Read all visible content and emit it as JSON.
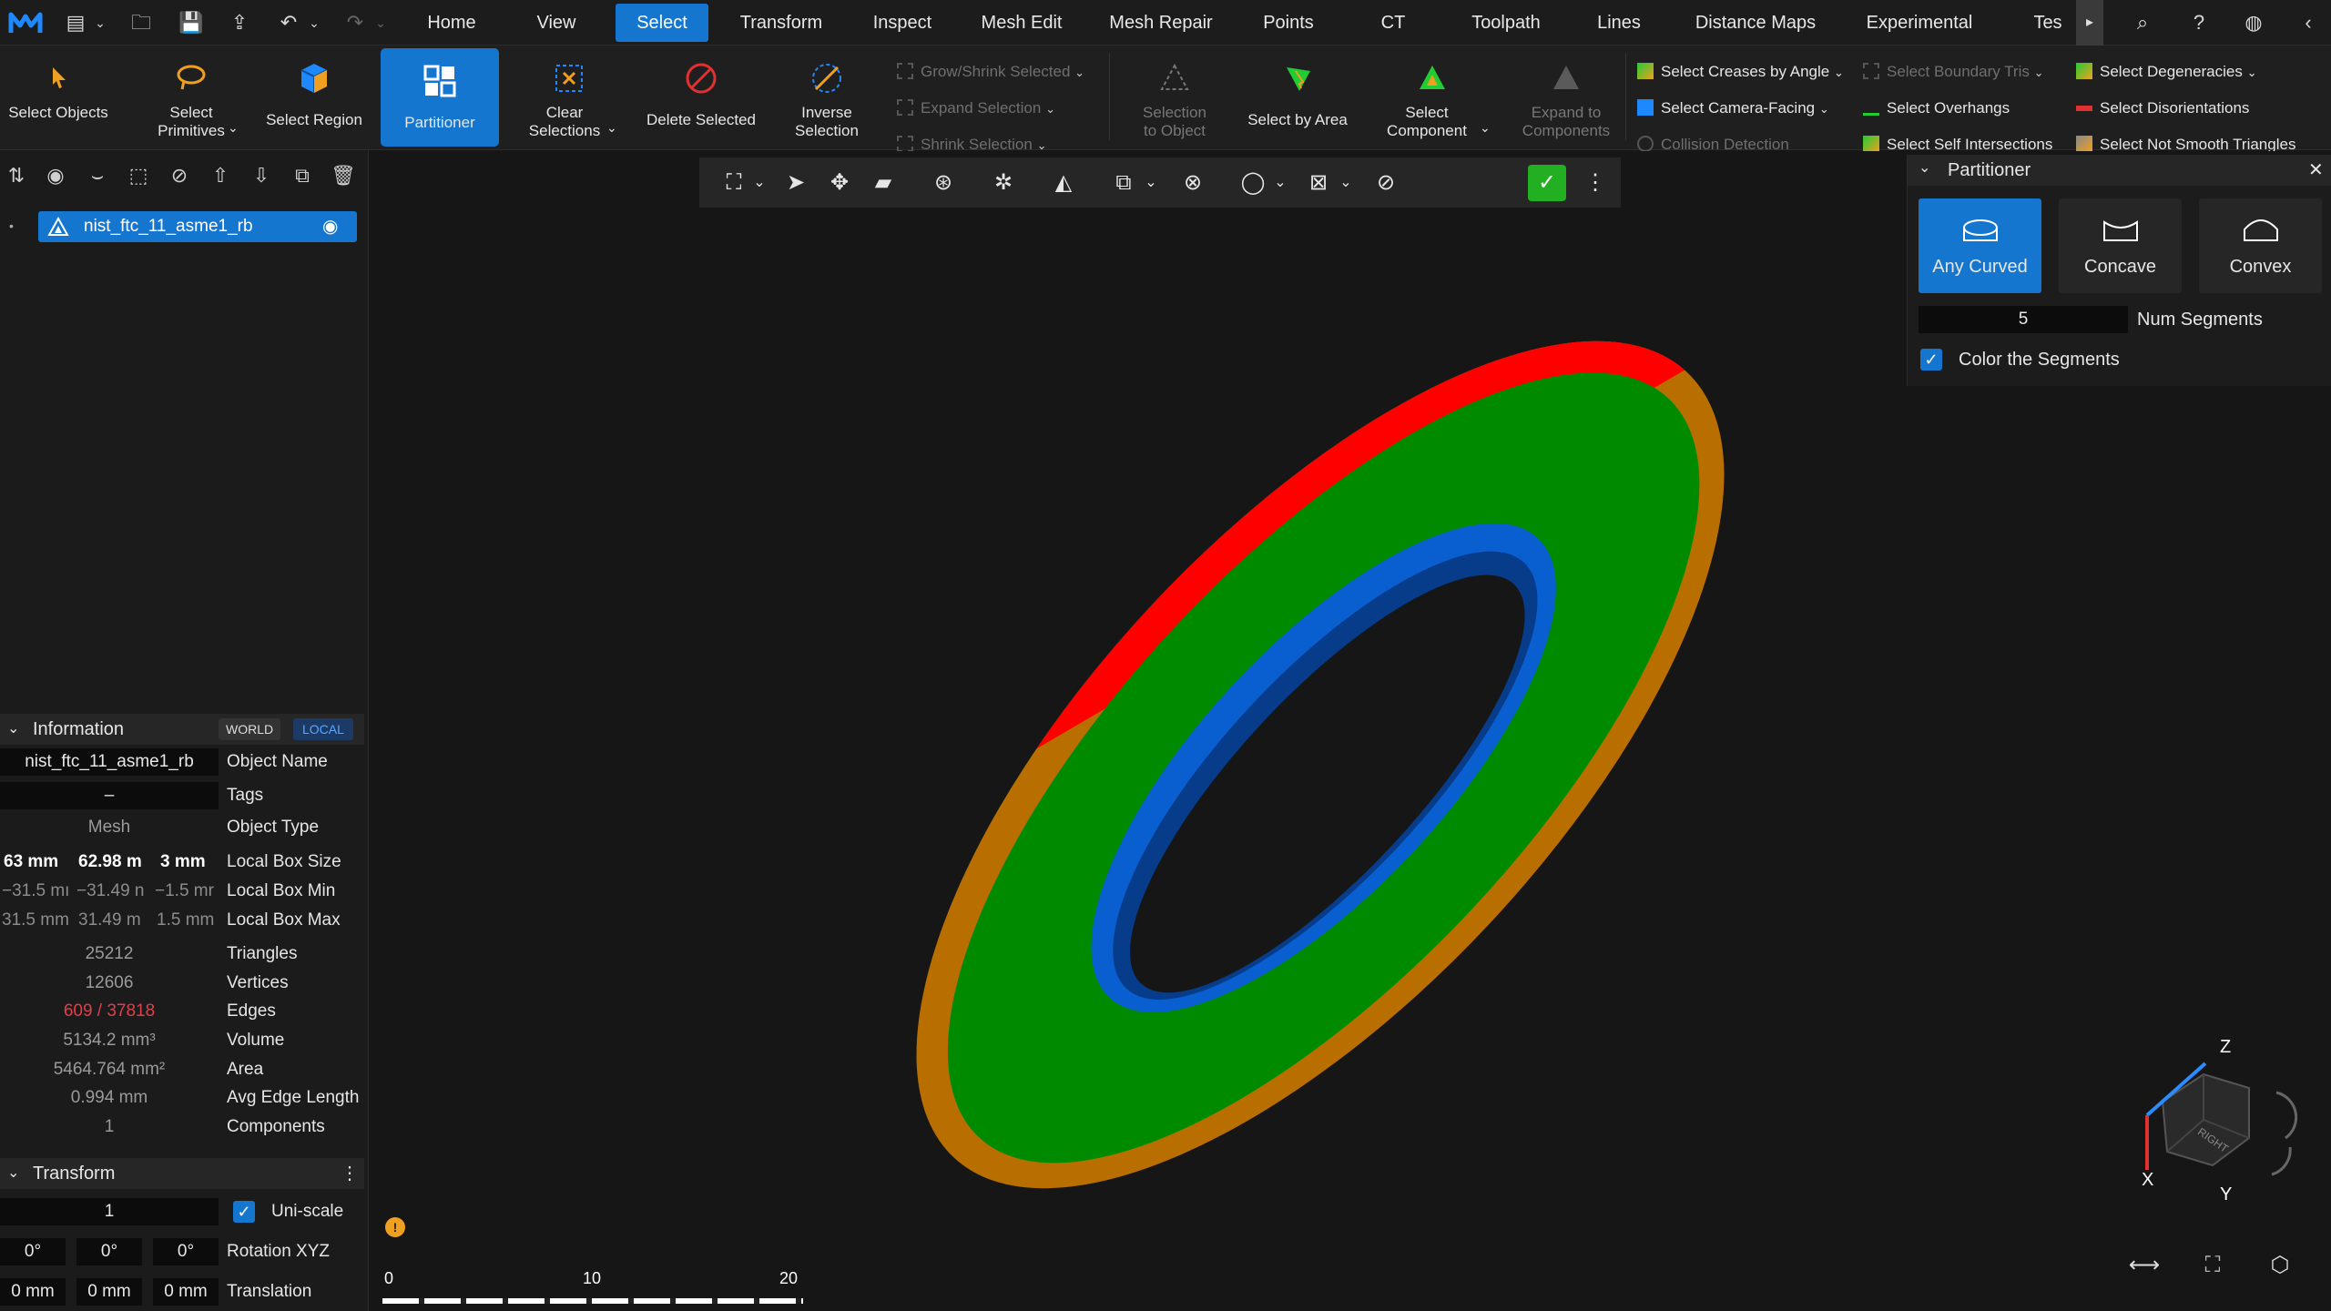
{
  "menu": {
    "tabs": [
      "Home",
      "View",
      "Select",
      "Transform",
      "Inspect",
      "Mesh Edit",
      "Mesh Repair",
      "Points",
      "CT",
      "Toolpath",
      "Lines",
      "Distance Maps",
      "Experimental",
      "Tes"
    ],
    "active_tab": "Select"
  },
  "ribbon": {
    "select_objects": "Select Objects",
    "select_primitives": "Select Primitives",
    "select_region": "Select Region",
    "partitioner": "Partitioner",
    "clear_selections": "Clear Selections",
    "delete_selected": "Delete Selected",
    "inverse_selection": "Inverse Selection",
    "grow_shrink": "Grow/Shrink Selected",
    "expand_selection": "Expand Selection",
    "shrink_selection": "Shrink Selection",
    "selection_to_object": "Selection to Object",
    "select_by_area": "Select by Area",
    "select_component": "Select Component",
    "expand_to_components": "Expand to Components",
    "select_creases": "Select Creases by Angle",
    "select_camera_facing": "Select Camera-Facing",
    "collision_detection": "Collision Detection",
    "select_boundary_tris": "Select Boundary Tris",
    "select_overhangs": "Select Overhangs",
    "select_self_intersections": "Select Self Intersections",
    "select_degeneracies": "Select Degeneracies",
    "select_disorientations": "Select Disorientations",
    "select_not_smooth": "Select Not Smooth Triangles"
  },
  "tree": {
    "object_name": "nist_ftc_11_asme1_rb"
  },
  "information": {
    "title": "Information",
    "world": "WORLD",
    "local": "LOCAL",
    "object_name_value": "nist_ftc_11_asme1_rb",
    "object_name_label": "Object Name",
    "tags_value": "–",
    "tags_label": "Tags",
    "type_value": "Mesh",
    "type_label": "Object Type",
    "box_size": [
      "63 mm",
      "62.98 m",
      "3 mm"
    ],
    "box_size_label": "Local Box Size",
    "box_min": [
      "−31.5 mı",
      "−31.49 n",
      "−1.5 mr"
    ],
    "box_min_label": "Local Box Min",
    "box_max": [
      "31.5 mm",
      "31.49 m",
      "1.5 mm"
    ],
    "box_max_label": "Local Box Max",
    "triangles": "25212",
    "triangles_label": "Triangles",
    "vertices": "12606",
    "vertices_label": "Vertices",
    "edges": "609 / 37818",
    "edges_label": "Edges",
    "volume": "5134.2 mm³",
    "volume_label": "Volume",
    "area": "5464.764 mm²",
    "area_label": "Area",
    "avg_edge": "0.994 mm",
    "avg_edge_label": "Avg Edge Length",
    "components": "1",
    "components_label": "Components"
  },
  "transform": {
    "title": "Transform",
    "scale": "1",
    "uniscale_label": "Uni-scale",
    "rotation": [
      "0°",
      "0°",
      "0°"
    ],
    "rotation_label": "Rotation XYZ",
    "translation": [
      "0 mm",
      "0 mm",
      "0 mm"
    ],
    "translation_label": "Translation"
  },
  "partitioner": {
    "title": "Partitioner",
    "modes": [
      "Any Curved",
      "Concave",
      "Convex"
    ],
    "active_mode": "Any Curved",
    "num_segments": "5",
    "num_segments_label": "Num Segments",
    "color_segments_label": "Color the Segments",
    "color_segments_checked": true
  },
  "scalebar": {
    "ticks": [
      "0",
      "10",
      "20"
    ]
  },
  "navcube": {
    "z": "Z",
    "x": "X",
    "y": "Y",
    "face": "RIGHT"
  },
  "colors": {
    "accent": "#1576d0",
    "segment_red": "#ff0000",
    "segment_green": "#008800",
    "segment_blue": "#0055cc",
    "segment_orange": "#c07a00",
    "edges_text": "#e0404a"
  }
}
